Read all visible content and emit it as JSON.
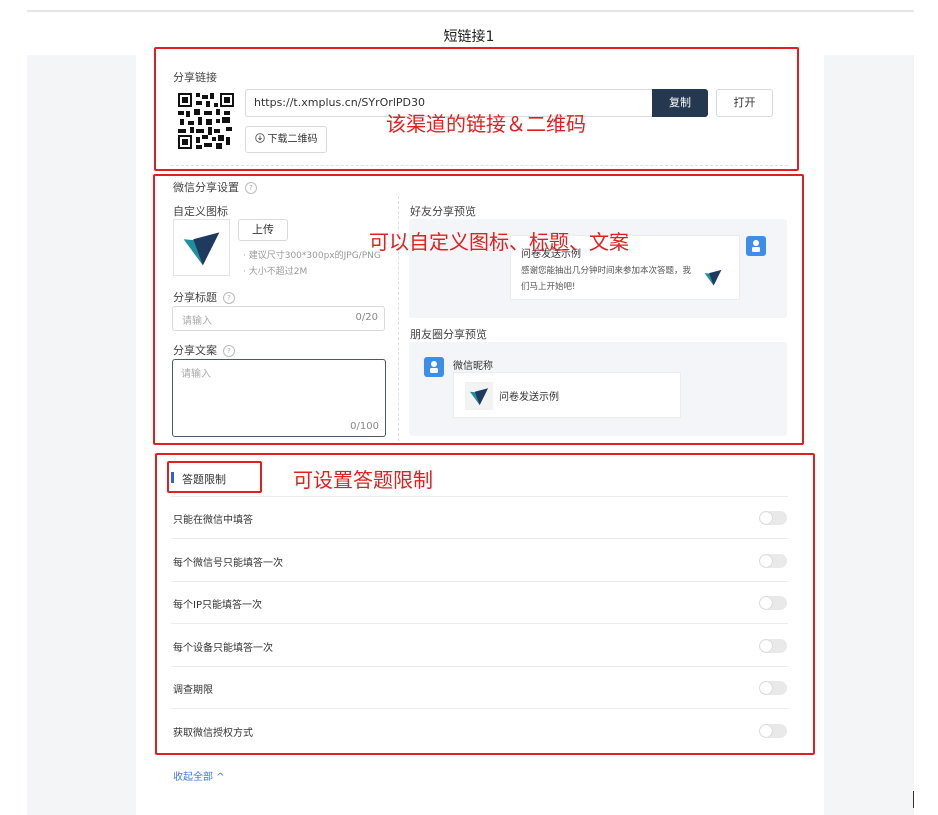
{
  "header": {
    "title": "短链接1"
  },
  "share_link": {
    "section_label": "分享链接",
    "url": "https://t.xmplus.cn/SYrOrlPD30",
    "copy_label": "复制",
    "open_label": "打开",
    "download_qr_label": "下载二维码",
    "annotation": "该渠道的链接＆二维码"
  },
  "wechat_share": {
    "section_label": "微信分享设置",
    "custom_icon_label": "自定义图标",
    "upload_label": "上传",
    "hint_size": "· 建议尺寸300*300px的JPG/PNG",
    "hint_max": "· 大小不超过2M",
    "title_label": "分享标题",
    "title_placeholder": "请输入",
    "title_counter": "0/20",
    "copy_text_label": "分享文案",
    "copy_text_placeholder": "请输入",
    "copy_text_counter": "0/100",
    "friend_preview_label": "好友分享预览",
    "friend_card_title": "问卷发送示例",
    "friend_card_desc_1": "感谢您能抽出几分钟时间来参加本次答题，我",
    "friend_card_desc_2": "们马上开始吧!",
    "moments_preview_label": "朋友圈分享预览",
    "wechat_nickname": "微信昵称",
    "moments_card_title": "问卷发送示例",
    "annotation": "可以自定义图标、标题、文案"
  },
  "restrictions": {
    "section_label": "答题限制",
    "annotation": "可设置答题限制",
    "items": [
      {
        "label": "只能在微信中填答",
        "enabled": false
      },
      {
        "label": "每个微信号只能填答一次",
        "enabled": false
      },
      {
        "label": "每个IP只能填答一次",
        "enabled": false
      },
      {
        "label": "每个设备只能填答一次",
        "enabled": false
      },
      {
        "label": "调查期限",
        "enabled": false
      },
      {
        "label": "获取微信授权方式",
        "enabled": false
      }
    ],
    "collapse_label": "收起全部 ^"
  },
  "colors": {
    "annotation_red": "#e02020",
    "copy_button_bg": "#24394f",
    "brand_blue": "#2a63d9",
    "logo_navy": "#1e3a5c",
    "logo_teal": "#1f8fa0"
  },
  "icons": {
    "download": "download-cloud-icon",
    "help": "question-circle-icon",
    "logo": "v-logo-icon",
    "avatar": "user-avatar-icon",
    "collapse": "chevron-up-icon"
  }
}
